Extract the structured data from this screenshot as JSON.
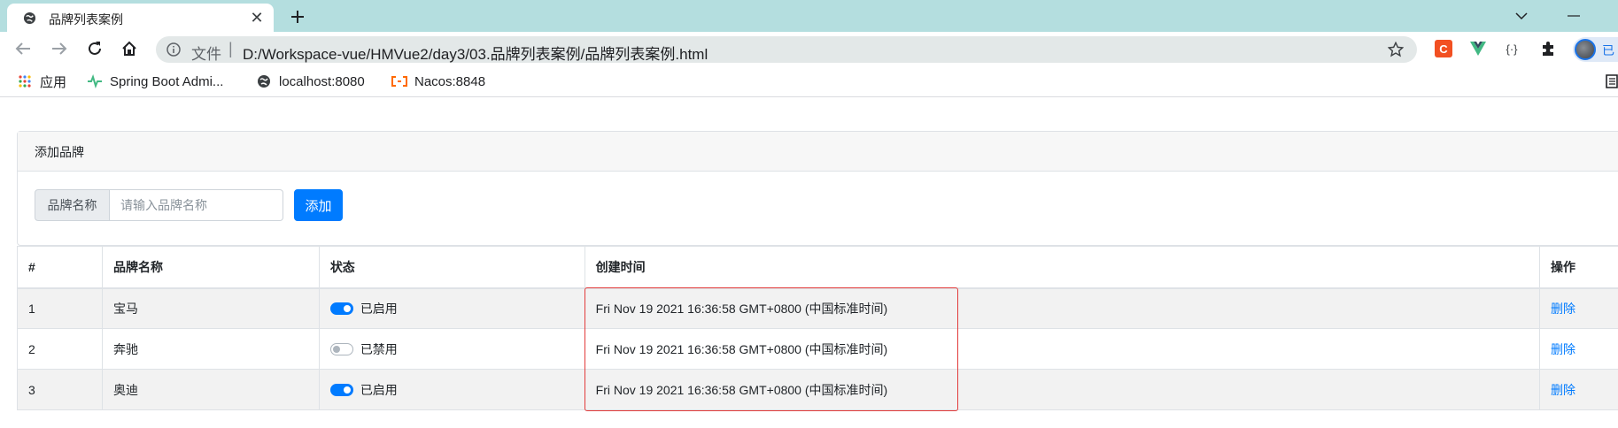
{
  "browser": {
    "tab_title": "品牌列表案例",
    "address_prefix": "文件",
    "address_separator": "|",
    "url": "D:/Workspace-vue/HMVue2/day3/03.品牌列表案例/品牌列表案例.html",
    "profile_label": "已",
    "bookmarks": [
      {
        "label": "应用",
        "icon": "apps-grid-icon"
      },
      {
        "label": "Spring Boot Admi...",
        "icon": "spring-boot-admin-icon"
      },
      {
        "label": "localhost:8080",
        "icon": "globe-icon"
      },
      {
        "label": "Nacos:8848",
        "icon": "nacos-icon"
      }
    ],
    "extensions": [
      {
        "label": "C",
        "icon": "ext-c-icon",
        "color": "#f25022"
      },
      {
        "label": "V",
        "icon": "vue-devtools-icon",
        "color": "#41b883"
      },
      {
        "label": "{·}",
        "icon": "json-viewer-icon",
        "color": "#3c4043"
      }
    ]
  },
  "card": {
    "header": "添加品牌",
    "input_label": "品牌名称",
    "input_placeholder": "请输入品牌名称",
    "input_value": "",
    "add_button": "添加"
  },
  "table": {
    "headers": [
      "#",
      "品牌名称",
      "状态",
      "创建时间",
      "操作"
    ],
    "rows": [
      {
        "id": "1",
        "name": "宝马",
        "enabled": true,
        "status": "已启用",
        "time": "Fri Nov 19 2021 16:36:58 GMT+0800 (中国标准时间)",
        "action": "删除"
      },
      {
        "id": "2",
        "name": "奔驰",
        "enabled": false,
        "status": "已禁用",
        "time": "Fri Nov 19 2021 16:36:58 GMT+0800 (中国标准时间)",
        "action": "删除"
      },
      {
        "id": "3",
        "name": "奥迪",
        "enabled": true,
        "status": "已启用",
        "time": "Fri Nov 19 2021 16:36:58 GMT+0800 (中国标准时间)",
        "action": "删除"
      }
    ]
  },
  "colors": {
    "primary": "#007bff",
    "highlight_box": "#e23b3b",
    "tabbar": "#b4dedf"
  }
}
